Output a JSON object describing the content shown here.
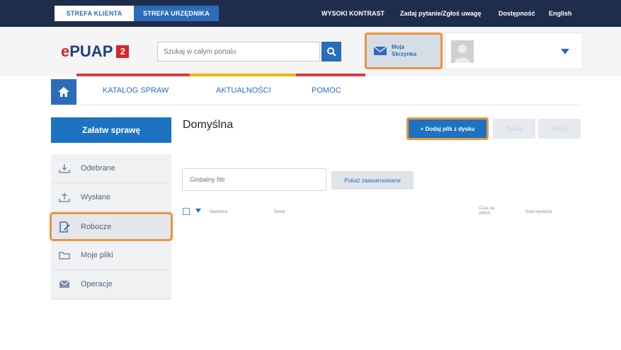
{
  "topbar": {
    "tab_klienta": "STREFA KLIENTA",
    "tab_urzednika": "STREFA URZĘDNIKA",
    "high_contrast": "WYSOKI KONTRAST",
    "ask_question": "Zadaj pytanie/Zgłoś uwagę",
    "accessibility": "Dostępność",
    "english": "English"
  },
  "header": {
    "logo_left": "e",
    "logo_main": "PUAP",
    "logo_badge": "2",
    "search_placeholder": "Szukaj w całym portalu",
    "inbox_line1": "Moja",
    "inbox_line2": "Skrzynka"
  },
  "strip_colors": [
    "#e0393e",
    "#f2b705",
    "#2b6db8",
    "#e0393e"
  ],
  "nav": {
    "items": [
      "KATALOG SPRAW",
      "AKTUALNOŚCI",
      "POMOC"
    ]
  },
  "sidebar": {
    "cta": "Załatw sprawę",
    "items": [
      {
        "label": "Odebrane",
        "icon": "inbox-download-icon"
      },
      {
        "label": "Wysłane",
        "icon": "outbox-upload-icon"
      },
      {
        "label": "Robocze",
        "icon": "draft-edit-icon"
      },
      {
        "label": "Moje pliki",
        "icon": "folder-icon"
      },
      {
        "label": "Operacje",
        "icon": "envelope-icon"
      }
    ],
    "active_index": 2
  },
  "main": {
    "title": "Domyślna",
    "add_file": "+ Dodaj plik z dysku",
    "btn_ghost1": "Dodaj",
    "btn_ghost2": "Anuluj",
    "filter_placeholder": "Globalny filtr",
    "show_extended": "Pokaż zaawansowane",
    "col_sender": "Nadawca",
    "col_subject": "Temat",
    "col_time_1": "Czas na",
    "col_time_2": "odbiór",
    "col_date": "Data wysłania"
  },
  "colors": {
    "brand_blue": "#2b6db8",
    "highlight_orange": "#e89441",
    "dark_navy": "#1f2d4c"
  }
}
